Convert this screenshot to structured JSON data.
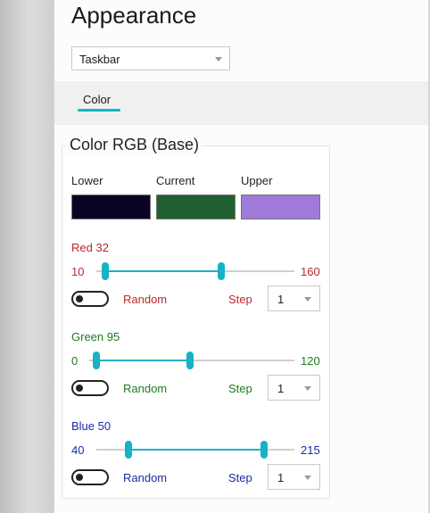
{
  "page": {
    "title": "Appearance"
  },
  "target_dropdown": {
    "value": "Taskbar"
  },
  "tabs": [
    {
      "label": "Color",
      "active": true
    }
  ],
  "group": {
    "title": "Color RGB (Base)",
    "swatches": [
      {
        "label": "Lower",
        "color": "#0b0326"
      },
      {
        "label": "Current",
        "color": "#1f5f32"
      },
      {
        "label": "Upper",
        "color": "#a07ad8"
      }
    ]
  },
  "channels": [
    {
      "key": "red",
      "label": "Red 32",
      "min_value": "10",
      "max_value": "160",
      "lower": 10,
      "upper": 160,
      "random_label": "Random",
      "random_on": false,
      "step_label": "Step",
      "step_value": "1",
      "color": "#c0262d"
    },
    {
      "key": "green",
      "label": "Green 95",
      "min_value": "0",
      "max_value": "120",
      "lower": 0,
      "upper": 120,
      "random_label": "Random",
      "random_on": false,
      "step_label": "Step",
      "step_value": "1",
      "color": "#1f7a1f"
    },
    {
      "key": "blue",
      "label": "Blue 50",
      "min_value": "40",
      "max_value": "215",
      "lower": 40,
      "upper": 215,
      "random_label": "Random",
      "random_on": false,
      "step_label": "Step",
      "step_value": "1",
      "color": "#1a2aa8"
    }
  ],
  "accent_color": "#14b4c4"
}
